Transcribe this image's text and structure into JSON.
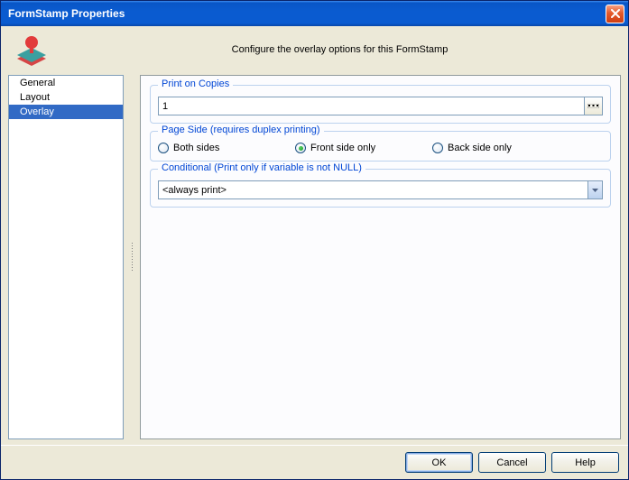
{
  "window": {
    "title": "FormStamp Properties",
    "close_aria": "Close"
  },
  "header": {
    "description": "Configure the overlay options for this FormStamp"
  },
  "nav": {
    "items": [
      {
        "label": "General",
        "selected": false
      },
      {
        "label": "Layout",
        "selected": false
      },
      {
        "label": "Overlay",
        "selected": true
      }
    ]
  },
  "groups": {
    "print_on_copies": {
      "legend": "Print on Copies",
      "value": "1",
      "ellipsis": "…"
    },
    "page_side": {
      "legend": "Page Side (requires duplex printing)",
      "options": {
        "both": "Both sides",
        "front": "Front side only",
        "back": "Back side only"
      },
      "selected": "front"
    },
    "conditional": {
      "legend": "Conditional (Print only if variable is not NULL)",
      "value": "<always print>"
    }
  },
  "buttons": {
    "ok": "OK",
    "cancel": "Cancel",
    "help": "Help"
  }
}
